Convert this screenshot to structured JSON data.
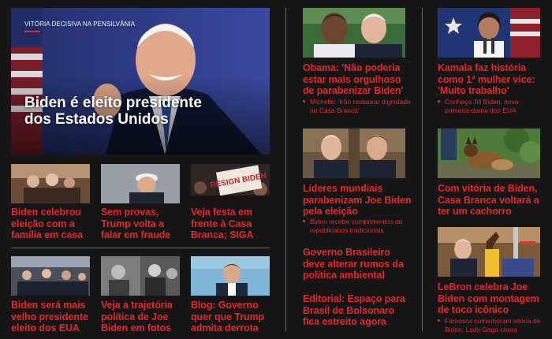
{
  "hero": {
    "kicker": "VITÓRIA DECISIVA NA PENSILVÂNIA",
    "title": "Biden é eleito presidente dos Estados Unidos"
  },
  "grid": [
    {
      "title": "Biden celebrou eleição com a família em casa"
    },
    {
      "title": "Sem provas, Trump volta a falar em fraude"
    },
    {
      "title": "Veja festa em frente à Casa Branca; SIGA",
      "sign_text": "RESIGN BIDEN"
    },
    {
      "title": "Biden será mais velho presidente eleito dos EUA"
    },
    {
      "title": "Veja a trajetória política de Joe Biden em fotos"
    },
    {
      "title": "Blog: Governo quer que Trump admita derrota"
    }
  ],
  "middle": [
    {
      "title": "Obama: 'Não poderia estar mais orgulhoso de parabenizar Biden'",
      "sub": "Michelle: 'Irão restaurar dignidade na Casa Branca'"
    },
    {
      "title": "Líderes mundiais parabenizam Joe Biden pela eleição",
      "sub": "Biden recebe cumprimentos de republicanos tradicionais"
    },
    {
      "title": "Governo Brasileiro deve alterar rumos da política ambiental"
    },
    {
      "title": "Editorial: Espaço para Brasil de Bolsonaro fica estreito agora"
    }
  ],
  "right": [
    {
      "title": "Kamala faz história como 1ª mulher vice: 'Muito trabalho'",
      "sub": "Conheça Jill Biden, nova primeira-dama dos EUA"
    },
    {
      "title": "Com vitória de Biden, Casa Branca voltará a ter um cachorro"
    },
    {
      "title": "LeBron celebra Joe Biden com montagem de toco icônico",
      "sub": "Famosos comemoram vitória de Biden; Lady Gaga chora"
    }
  ],
  "colors": {
    "background": "#161616",
    "accent": "#e6262b",
    "divider": "#6a6a6a"
  }
}
